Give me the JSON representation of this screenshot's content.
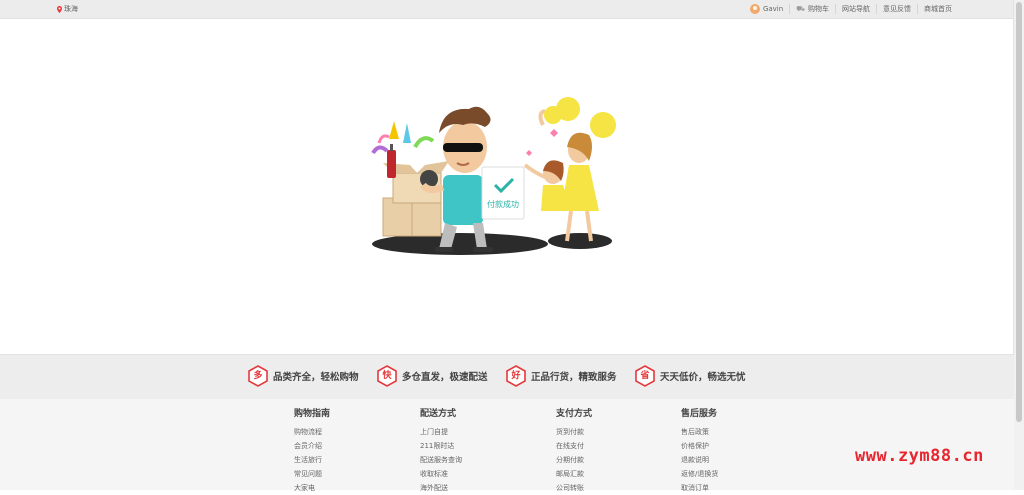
{
  "topbar": {
    "location": "珠海",
    "user": "Gavin",
    "cart": "购物车",
    "site_nav": "网站导航",
    "feedback": "意见反馈",
    "mall_home": "商城首页"
  },
  "illustration": {
    "badge_text": "付款成功"
  },
  "guarantees": [
    {
      "icon_char": "多",
      "text": "品类齐全，轻松购物"
    },
    {
      "icon_char": "快",
      "text": "多仓直发，极速配送"
    },
    {
      "icon_char": "好",
      "text": "正品行货，精致服务"
    },
    {
      "icon_char": "省",
      "text": "天天低价，畅选无忧"
    }
  ],
  "footer": {
    "columns": [
      {
        "title": "购物指南",
        "links": [
          "购物流程",
          "会员介绍",
          "生活旅行",
          "常见问题",
          "大家电"
        ]
      },
      {
        "title": "配送方式",
        "links": [
          "上门自提",
          "211限时达",
          "配送服务查询",
          "收取标准",
          "海外配送"
        ]
      },
      {
        "title": "支付方式",
        "links": [
          "货到付款",
          "在线支付",
          "分期付款",
          "邮局汇款",
          "公司转账"
        ]
      },
      {
        "title": "售后服务",
        "links": [
          "售后政策",
          "价格保护",
          "退款说明",
          "返修/退换货",
          "取消订单"
        ]
      }
    ]
  },
  "watermark": "www.zym88.cn",
  "colors": {
    "accent_red": "#e4393c",
    "topbar_bg": "#ececec",
    "strip_bg": "#ededed"
  }
}
